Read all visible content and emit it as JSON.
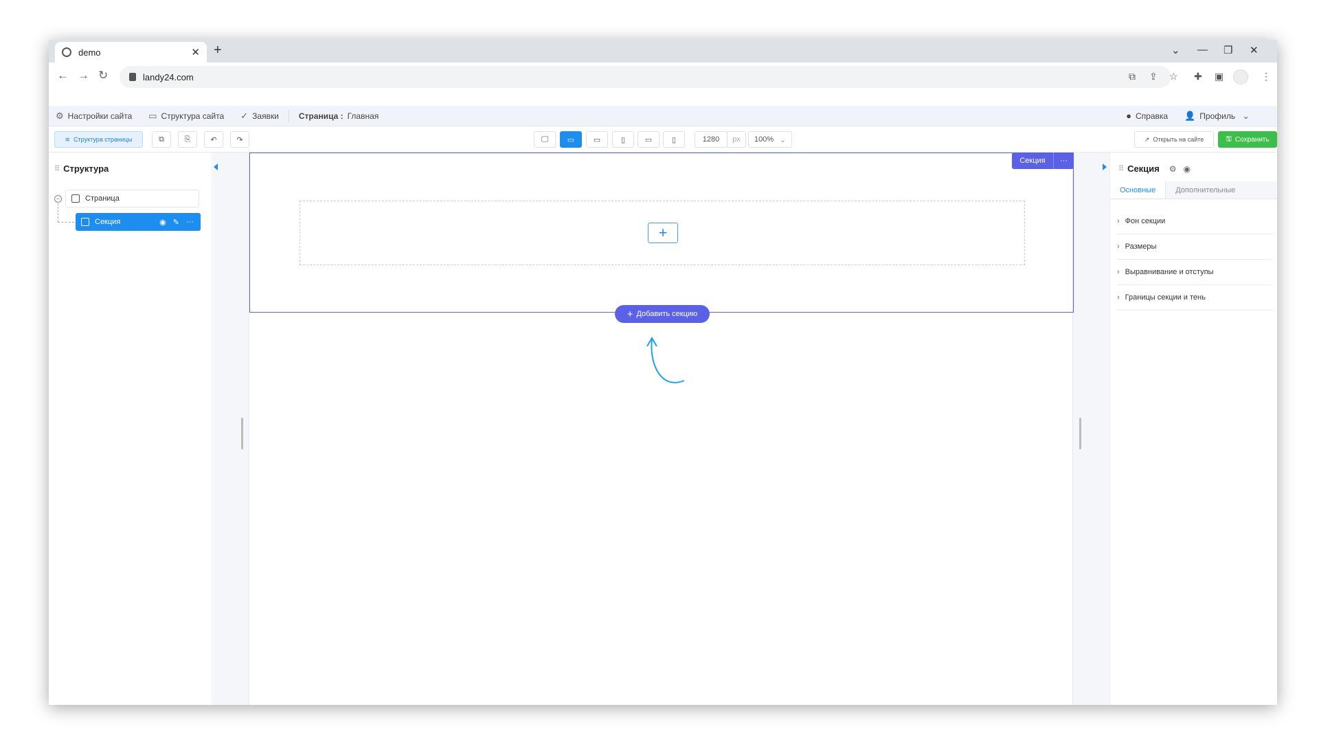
{
  "browser": {
    "tab_title": "demo",
    "url": "landy24.com",
    "tab_close": "✕",
    "new_tab": "+",
    "controls": {
      "chevron": "⌄",
      "minimize": "—",
      "restore": "❐",
      "close": "✕"
    }
  },
  "app_menu": {
    "site_settings": "Настройки сайта",
    "site_structure": "Структура сайта",
    "requests": "Заявки",
    "page_label": "Страница :",
    "page_name": "Главная",
    "help": "Справка",
    "profile": "Профиль"
  },
  "toolbar": {
    "page_structure": "Структура страницы",
    "width_value": "1280",
    "width_unit": "px",
    "zoom": "100%",
    "open_on_site": "Открыть на сайте",
    "save": "Сохранить"
  },
  "left_panel": {
    "title": "Структура",
    "tree": {
      "page": "Страница",
      "section": "Секция"
    }
  },
  "canvas": {
    "section_tag": "Секция",
    "section_more": "···",
    "add_block": "+",
    "add_section": "Добавить секцию"
  },
  "right_panel": {
    "title": "Секция",
    "tabs": [
      "Основные",
      "Дополнительные"
    ],
    "accordion": [
      "Фон секции",
      "Размеры",
      "Выравнивание и отступы",
      "Границы секции и тень"
    ]
  },
  "colors": {
    "accent_blue": "#1d8ef0",
    "section_purple": "#5b61e6",
    "save_green": "#3cbf4a",
    "hint_arrow": "#1aa3e8"
  }
}
